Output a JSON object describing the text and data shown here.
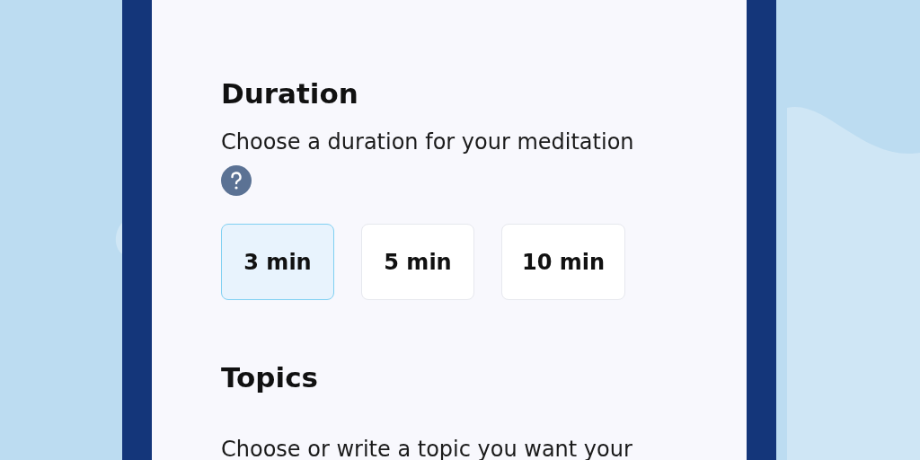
{
  "duration": {
    "heading": "Duration",
    "description": "Choose a duration for your meditation",
    "options": [
      {
        "label": "3 min",
        "selected": true
      },
      {
        "label": "5 min",
        "selected": false
      },
      {
        "label": "10 min",
        "selected": false
      }
    ]
  },
  "topics": {
    "heading": "Topics",
    "description": "Choose or write a topic you want your"
  }
}
